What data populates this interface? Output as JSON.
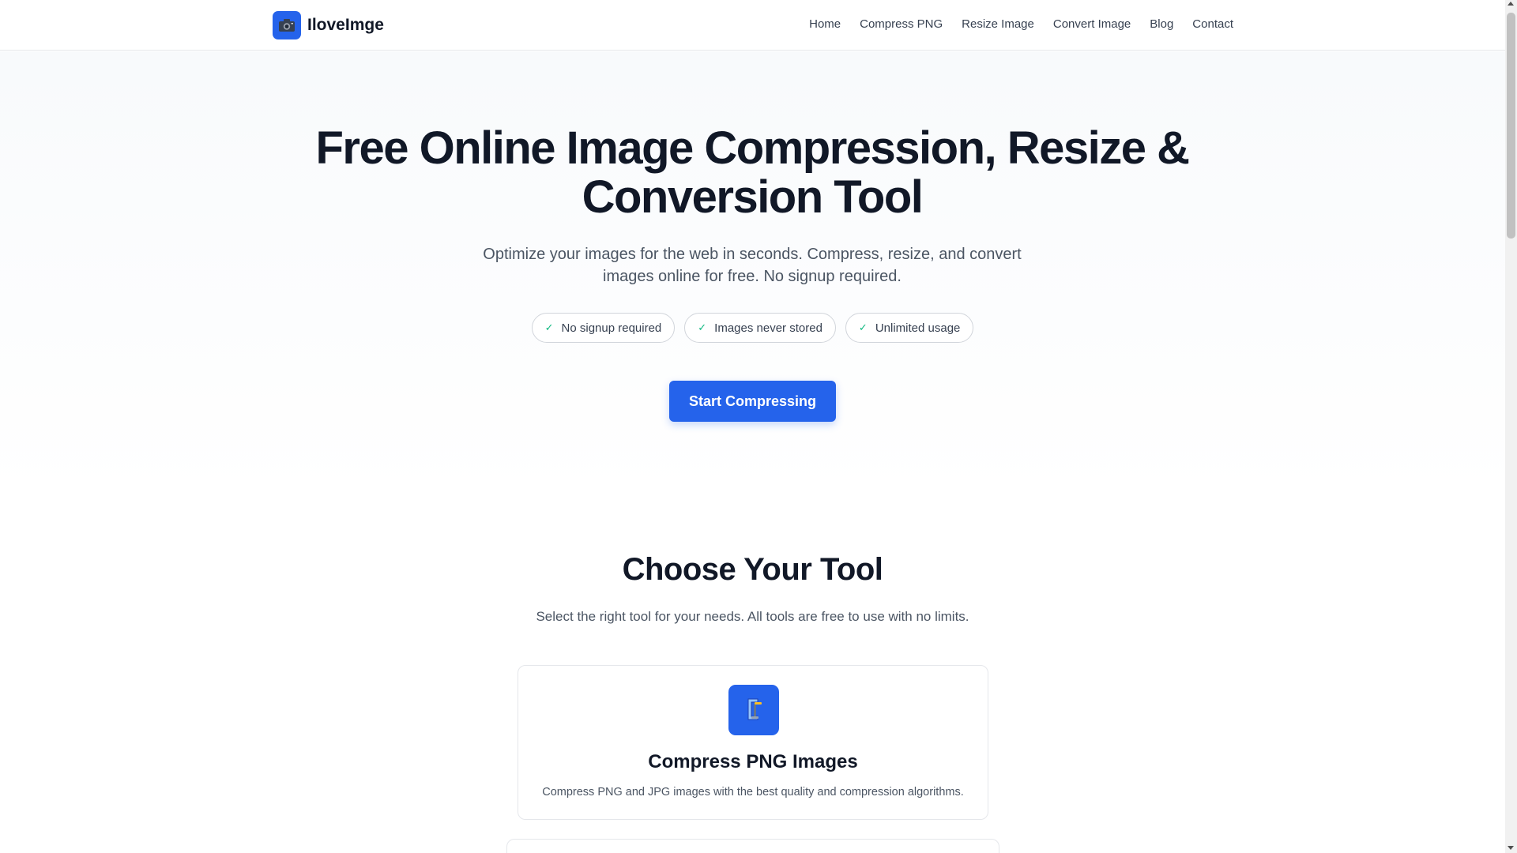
{
  "header": {
    "brand": "IloveImge",
    "logo_icon": "camera-icon",
    "nav": [
      "Home",
      "Compress PNG",
      "Resize Image",
      "Convert Image",
      "Blog",
      "Contact"
    ]
  },
  "hero": {
    "title_line1": "Free Online Image Compression, Resize &",
    "title_line2": "Conversion Tool",
    "subtitle_line1": "Optimize your images for the web in seconds. Compress, resize, and convert",
    "subtitle_line2": "images online for free. No signup required.",
    "badges": [
      "No signup required",
      "Images never stored",
      "Unlimited usage"
    ],
    "badge_check": "✓",
    "cta": "Start Compressing"
  },
  "tools": {
    "title": "Choose Your Tool",
    "subtitle": "Select the right tool for your needs. All tools are free to use with no limits.",
    "cards": [
      {
        "icon": "clamp-icon",
        "title": "Compress PNG Images",
        "description": "Compress PNG and JPG images with the best quality and compression algorithms."
      }
    ]
  },
  "colors": {
    "primary": "#2563eb",
    "heading": "#111827",
    "body_text": "#4b5563",
    "check": "#10b981",
    "border": "#e5e7eb"
  }
}
